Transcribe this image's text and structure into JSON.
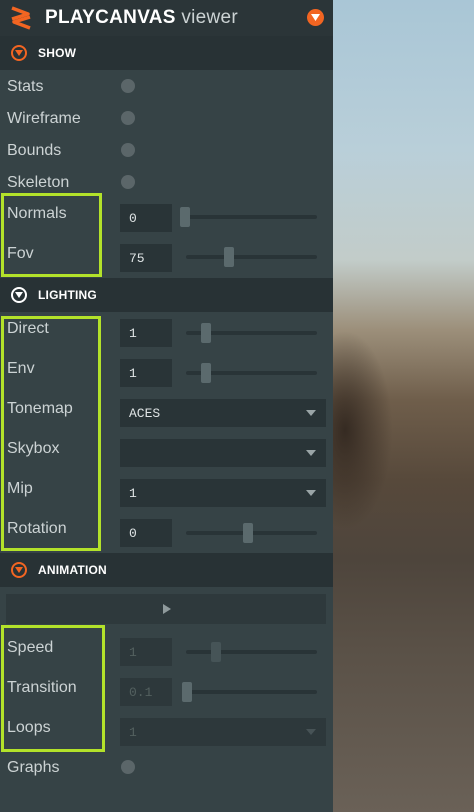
{
  "app": {
    "brand": "PLAYCANVAS",
    "subtitle": " viewer"
  },
  "colors": {
    "accent": "#f26522",
    "highlight": "#b3e22a",
    "panel": "#364346"
  },
  "icons": {
    "logo": "playcanvas-logo-icon",
    "menu": "chevron-down-icon"
  },
  "show": {
    "title": "SHOW",
    "stats": {
      "label": "Stats",
      "on": false
    },
    "wireframe": {
      "label": "Wireframe",
      "on": false
    },
    "bounds": {
      "label": "Bounds",
      "on": false
    },
    "skeleton": {
      "label": "Skeleton",
      "on": false
    },
    "normals": {
      "label": "Normals",
      "value": "0",
      "slider_fraction": 0.0
    },
    "fov": {
      "label": "Fov",
      "value": "75",
      "slider_fraction": 0.3
    }
  },
  "lighting": {
    "title": "LIGHTING",
    "direct": {
      "label": "Direct",
      "value": "1",
      "slider_fraction": 0.1
    },
    "env": {
      "label": "Env",
      "value": "1",
      "slider_fraction": 0.1
    },
    "tonemap": {
      "label": "Tonemap",
      "value": "ACES"
    },
    "skybox": {
      "label": "Skybox",
      "value": ""
    },
    "mip": {
      "label": "Mip",
      "value": "1"
    },
    "rotation": {
      "label": "Rotation",
      "value": "0",
      "slider_fraction": 0.45
    }
  },
  "animation": {
    "title": "ANIMATION",
    "speed": {
      "label": "Speed",
      "value": "1",
      "slider_fraction": 0.2
    },
    "transition": {
      "label": "Transition",
      "value": "0.1",
      "slider_fraction": 0.0
    },
    "loops": {
      "label": "Loops",
      "value": "1"
    },
    "graphs": {
      "label": "Graphs",
      "on": false
    }
  }
}
